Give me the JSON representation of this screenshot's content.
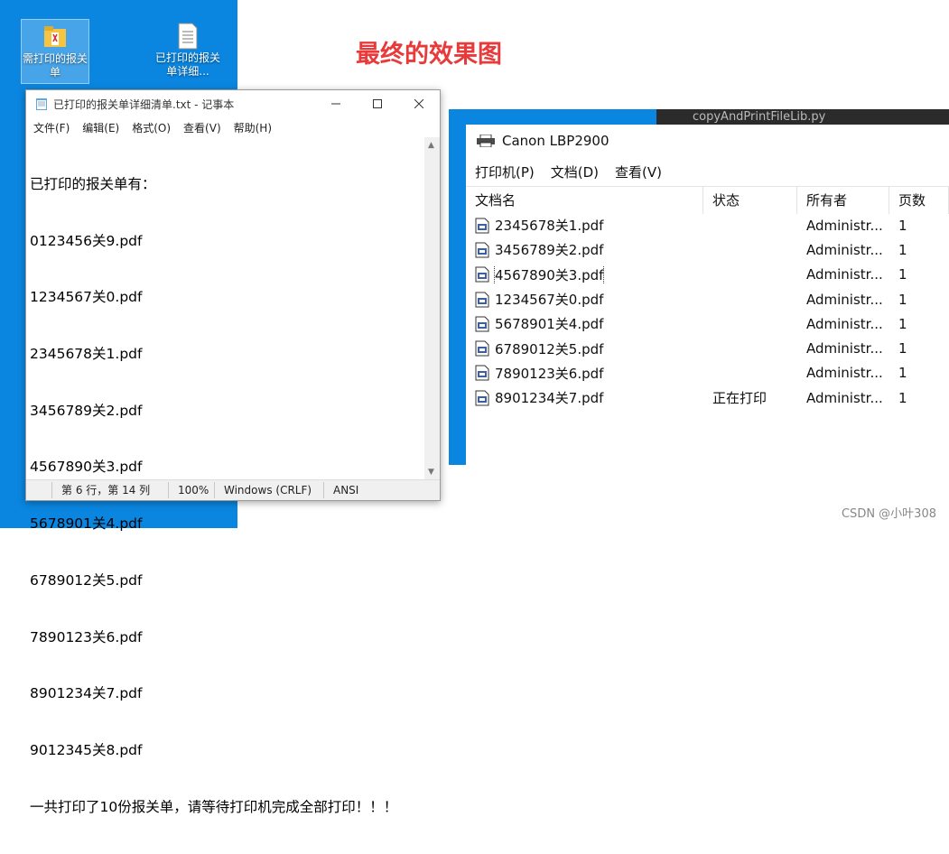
{
  "headline": "最终的效果图",
  "desktop": {
    "icons": [
      {
        "label": "需打印的报关单"
      },
      {
        "label": "已打印的报关单详细..."
      }
    ]
  },
  "notepad": {
    "title": "已打印的报关单详细清单.txt - 记事本",
    "menu": [
      "文件(F)",
      "编辑(E)",
      "格式(O)",
      "查看(V)",
      "帮助(H)"
    ],
    "lines": [
      "已打印的报关单有：",
      "0123456关9.pdf",
      "1234567关0.pdf",
      "2345678关1.pdf",
      "3456789关2.pdf",
      "4567890关3.pdf",
      "5678901关4.pdf",
      "6789012关5.pdf",
      "7890123关6.pdf",
      "8901234关7.pdf",
      "9012345关8.pdf",
      "一共打印了10份报关单，请等待打印机完成全部打印！！！"
    ],
    "status": {
      "position": "第 6 行，第 14 列",
      "zoom": "100%",
      "line_ending": "Windows (CRLF)",
      "encoding": "ANSI"
    }
  },
  "background_strip": "copyAndPrintFileLib.py",
  "print_queue": {
    "title": "Canon LBP2900",
    "menu": [
      "打印机(P)",
      "文档(D)",
      "查看(V)"
    ],
    "columns": [
      "文档名",
      "状态",
      "所有者",
      "页数"
    ],
    "rows": [
      {
        "name": "2345678关1.pdf",
        "status": "",
        "owner": "Administr...",
        "pages": "1"
      },
      {
        "name": "3456789关2.pdf",
        "status": "",
        "owner": "Administr...",
        "pages": "1"
      },
      {
        "name": "4567890关3.pdf",
        "status": "",
        "owner": "Administr...",
        "pages": "1"
      },
      {
        "name": "1234567关0.pdf",
        "status": "",
        "owner": "Administr...",
        "pages": "1"
      },
      {
        "name": "5678901关4.pdf",
        "status": "",
        "owner": "Administr...",
        "pages": "1"
      },
      {
        "name": "6789012关5.pdf",
        "status": "",
        "owner": "Administr...",
        "pages": "1"
      },
      {
        "name": "7890123关6.pdf",
        "status": "",
        "owner": "Administr...",
        "pages": "1"
      },
      {
        "name": "8901234关7.pdf",
        "status": "正在打印",
        "owner": "Administr...",
        "pages": "1"
      }
    ]
  },
  "watermark": "CSDN @小叶308",
  "colors": {
    "desktop_blue": "#0a86e0",
    "headline_red": "#e83a3a"
  }
}
